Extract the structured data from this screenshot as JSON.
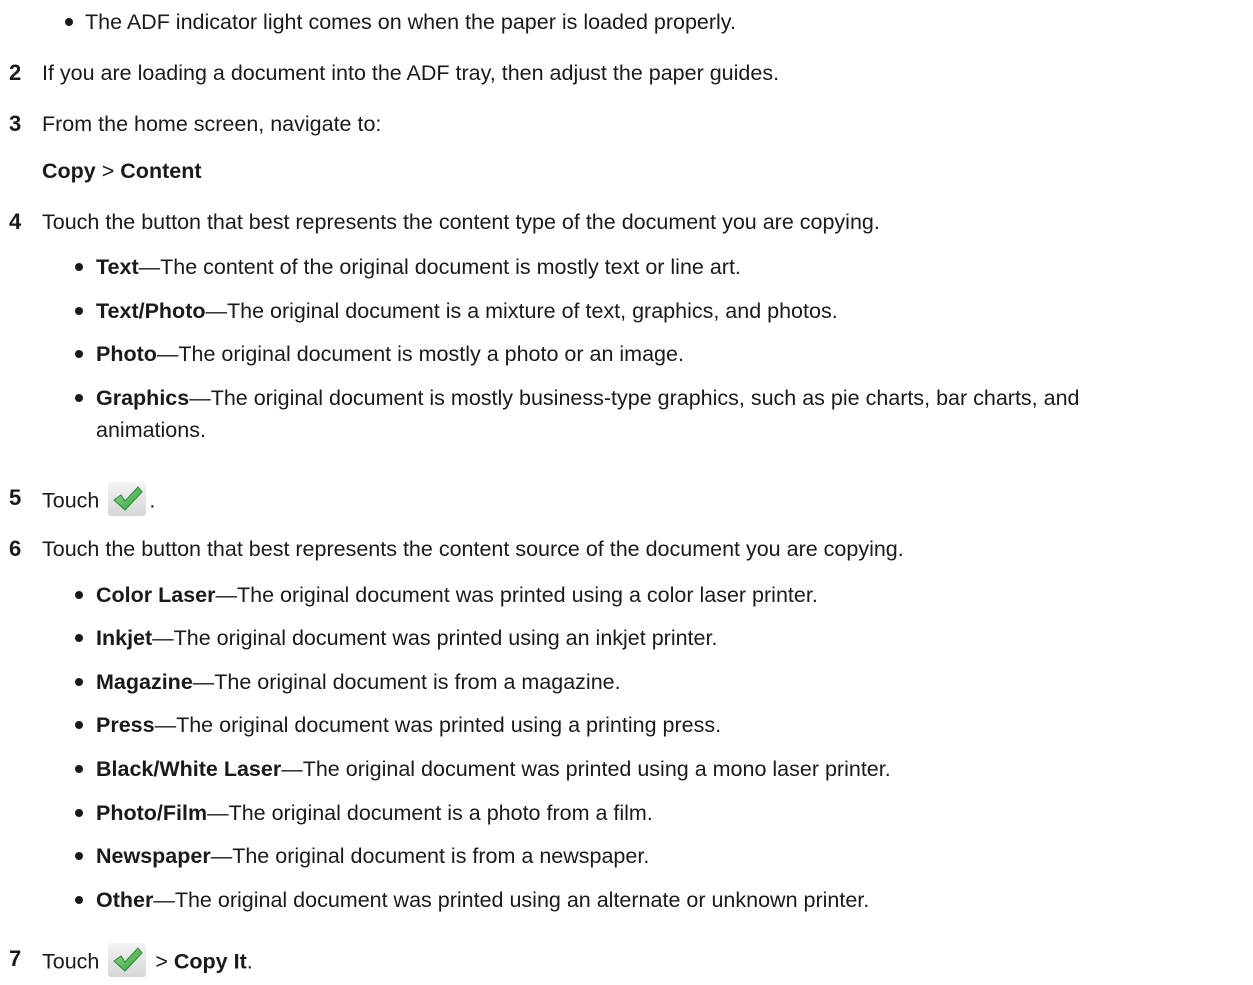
{
  "intro_bullet": "The ADF indicator light comes on when the paper is loaded properly.",
  "steps": [
    {
      "num": "2",
      "text": "If you are loading a document into the ADF tray, then adjust the paper guides."
    },
    {
      "num": "3",
      "text": "From the home screen, navigate to:"
    },
    {
      "num": "4",
      "text": "Touch the button that best represents the content type of the document you are copying."
    },
    {
      "num": "5",
      "text_before": "Touch",
      "text_after": "."
    },
    {
      "num": "6",
      "text": "Touch the button that best represents the content source of the document you are copying."
    },
    {
      "num": "7",
      "text_before": "Touch",
      "sep": ">",
      "action": "Copy It",
      "text_after": "."
    }
  ],
  "menu_path": {
    "first": "Copy",
    "sep": ">",
    "second": "Content"
  },
  "content_types": [
    {
      "term": "Text",
      "desc": "—The content of the original document is mostly text or line art."
    },
    {
      "term": "Text/Photo",
      "desc": "—The original document is a mixture of text, graphics, and photos."
    },
    {
      "term": "Photo",
      "desc": "—The original document is mostly a photo or an image."
    },
    {
      "term": "Graphics",
      "desc": "—The original document is mostly business-type graphics, such as pie charts, bar charts, and",
      "desc_cont": "animations."
    }
  ],
  "content_sources": [
    {
      "term": "Color Laser",
      "desc": "—The original document was printed using a color laser printer."
    },
    {
      "term": "Inkjet",
      "desc": "—The original document was printed using an inkjet printer."
    },
    {
      "term": "Magazine",
      "desc": "—The original document is from a magazine."
    },
    {
      "term": "Press",
      "desc": "—The original document was printed using a printing press."
    },
    {
      "term": "Black/White Laser",
      "desc": "—The original document was printed using a mono laser printer."
    },
    {
      "term": "Photo/Film",
      "desc": "—The original document is a photo from a film."
    },
    {
      "term": "Newspaper",
      "desc": "—The original document is from a newspaper."
    },
    {
      "term": "Other",
      "desc": "—The original document was printed using an alternate or unknown printer."
    }
  ],
  "icons": {
    "checkmark": "checkmark-icon",
    "checkmark_color": "#4caf50"
  }
}
